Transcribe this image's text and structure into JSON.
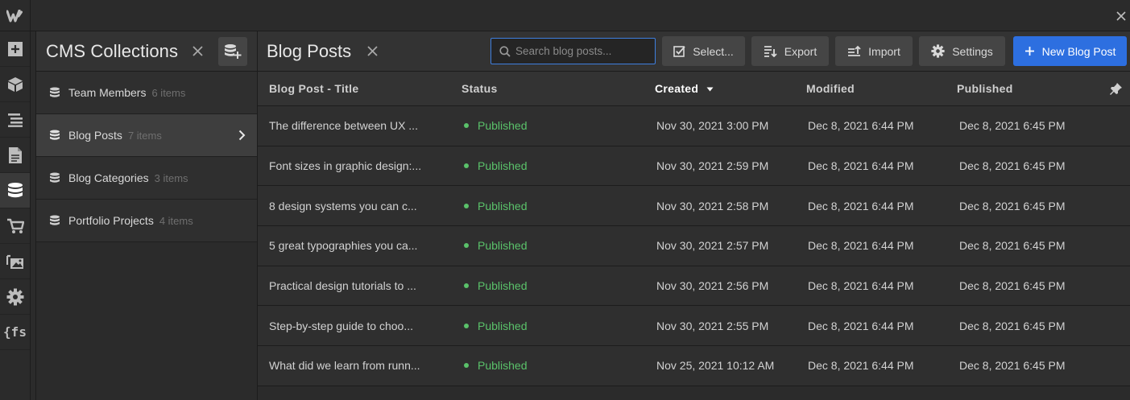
{
  "app": {
    "logo_letter": "W"
  },
  "rail": {
    "icons": [
      "add-icon",
      "box-icon",
      "navigator-icon",
      "pages-icon",
      "cms-icon",
      "ecommerce-icon",
      "assets-icon",
      "settings-icon",
      "finsweet-icon"
    ],
    "fs_label": "{fs"
  },
  "collections_panel": {
    "title": "CMS Collections",
    "items": [
      {
        "name": "Team Members",
        "count": "6 items"
      },
      {
        "name": "Blog Posts",
        "count": "7 items"
      },
      {
        "name": "Blog Categories",
        "count": "3 items"
      },
      {
        "name": "Portfolio Projects",
        "count": "4 items"
      }
    ]
  },
  "main": {
    "title": "Blog Posts",
    "search_placeholder": "Search blog posts...",
    "buttons": {
      "select": "Select...",
      "export": "Export",
      "import": "Import",
      "settings": "Settings",
      "new_post": "New Blog Post"
    },
    "columns": [
      "Blog Post - Title",
      "Status",
      "Created",
      "Modified",
      "Published"
    ],
    "rows": [
      {
        "title": "The difference between UX ...",
        "status": "Published",
        "created": "Nov 30, 2021 3:00 PM",
        "modified": "Dec 8, 2021 6:44 PM",
        "published": "Dec 8, 2021 6:45 PM"
      },
      {
        "title": "Font sizes in graphic design:...",
        "status": "Published",
        "created": "Nov 30, 2021 2:59 PM",
        "modified": "Dec 8, 2021 6:44 PM",
        "published": "Dec 8, 2021 6:45 PM"
      },
      {
        "title": "8 design systems you can c...",
        "status": "Published",
        "created": "Nov 30, 2021 2:58 PM",
        "modified": "Dec 8, 2021 6:44 PM",
        "published": "Dec 8, 2021 6:45 PM"
      },
      {
        "title": "5 great typographies you ca...",
        "status": "Published",
        "created": "Nov 30, 2021 2:57 PM",
        "modified": "Dec 8, 2021 6:44 PM",
        "published": "Dec 8, 2021 6:45 PM"
      },
      {
        "title": "Practical design tutorials to ...",
        "status": "Published",
        "created": "Nov 30, 2021 2:56 PM",
        "modified": "Dec 8, 2021 6:44 PM",
        "published": "Dec 8, 2021 6:45 PM"
      },
      {
        "title": "Step-by-step guide to choo...",
        "status": "Published",
        "created": "Nov 30, 2021 2:55 PM",
        "modified": "Dec 8, 2021 6:44 PM",
        "published": "Dec 8, 2021 6:45 PM"
      },
      {
        "title": "What did we learn from runn...",
        "status": "Published",
        "created": "Nov 25, 2021 10:12 AM",
        "modified": "Dec 8, 2021 6:44 PM",
        "published": "Dec 8, 2021 6:45 PM"
      }
    ]
  },
  "colors": {
    "accent": "#2d6fe0",
    "published": "#5ac26a"
  }
}
